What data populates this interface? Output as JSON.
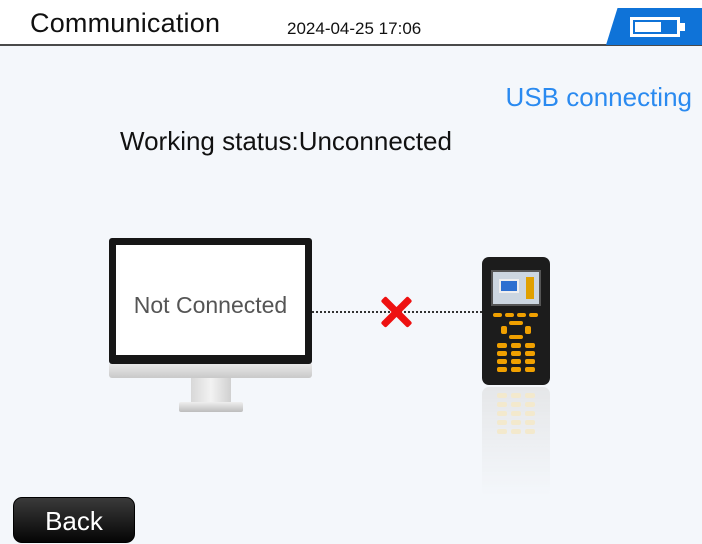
{
  "header": {
    "title": "Communication",
    "datetime": "2024-04-25 17:06",
    "battery_icon": "battery-icon",
    "accent_color": "#0f73d8"
  },
  "main": {
    "mode_label": "USB connecting",
    "status_text": "Working status:Unconnected",
    "monitor_text": "Not Connected",
    "link_icon": "disconnected-cross-icon",
    "computer_icon": "monitor-icon",
    "device_icon": "handheld-device-icon"
  },
  "footer": {
    "back_label": "Back"
  }
}
